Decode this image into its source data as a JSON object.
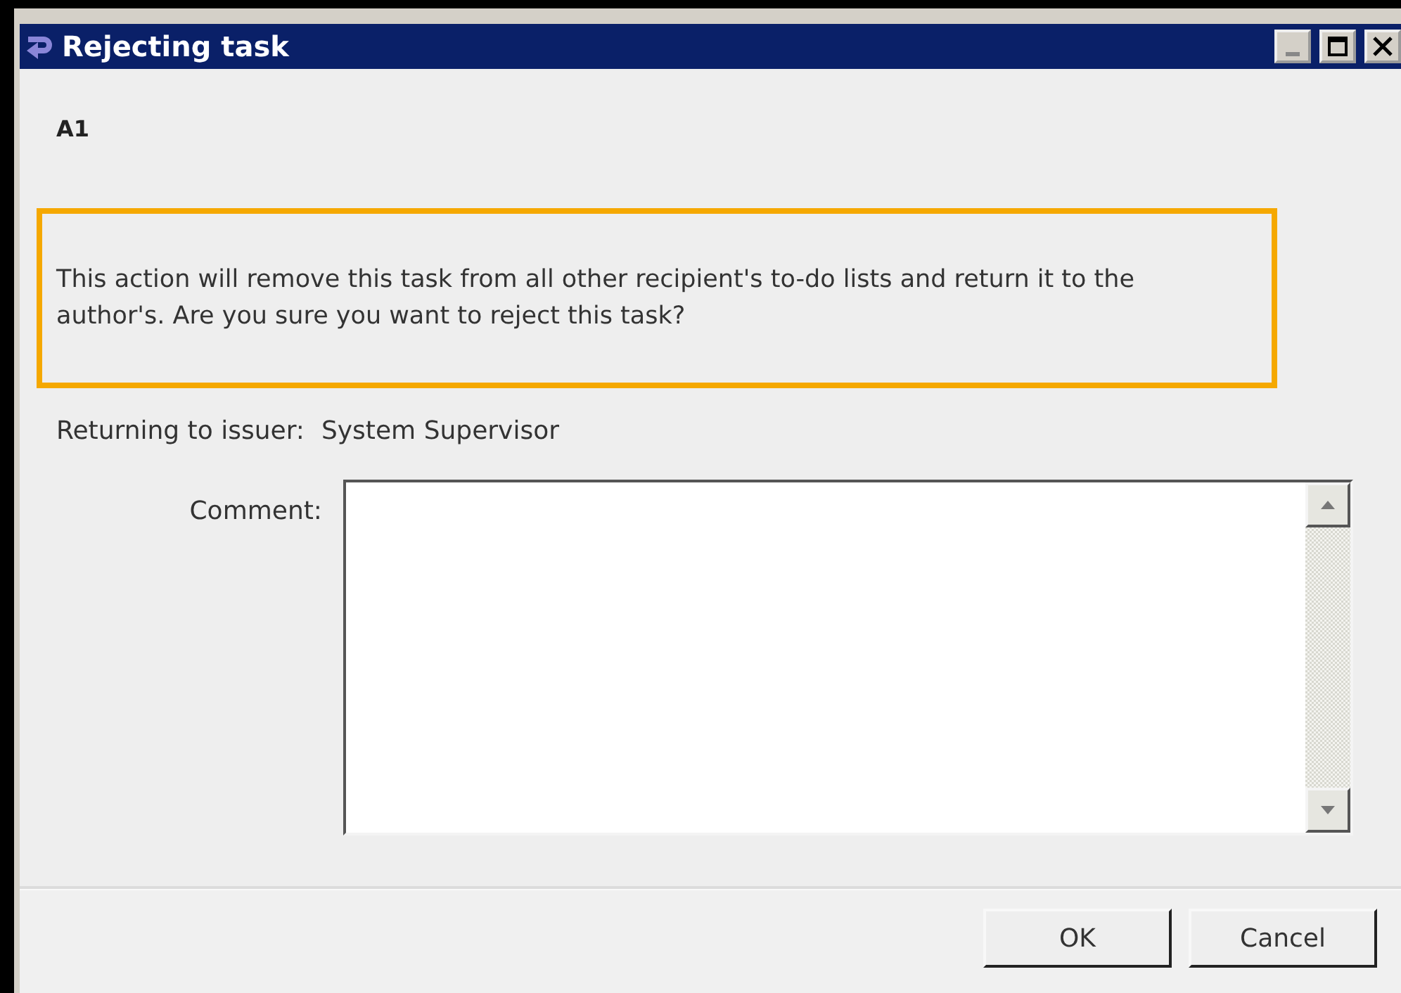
{
  "window": {
    "title": "Rejecting task"
  },
  "task_name": "A1",
  "warning": "This action will remove this task from all other recipient's to-do lists and return it to the author's. Are you sure you want to reject this task?",
  "issuer": {
    "label": "Returning to issuer:",
    "value": "System Supervisor"
  },
  "comment": {
    "label": "Comment:"
  },
  "buttons": [
    {
      "label": "OK"
    },
    {
      "label": "Cancel"
    }
  ]
}
